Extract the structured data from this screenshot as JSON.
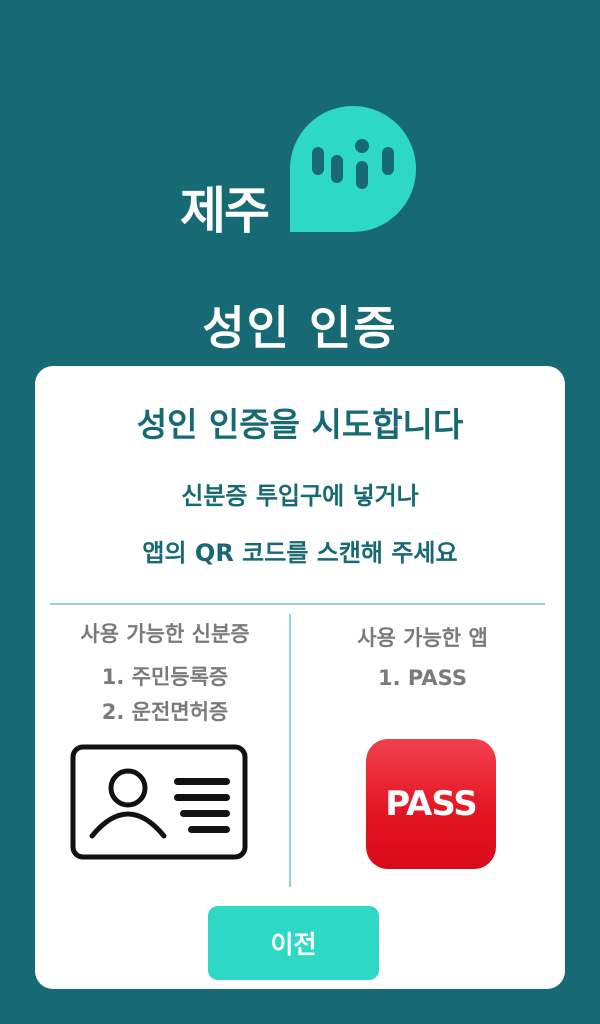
{
  "logo": {
    "text": "제주",
    "icon": "speech-bubble-logo-icon",
    "color": "#2dd8c4"
  },
  "page_title": "성인 인증",
  "card": {
    "heading": "성인 인증을 시도합니다",
    "instruction_line1": "신분증 투입구에 넣거나",
    "instruction_line2": "앱의 QR 코드를 스캔해 주세요"
  },
  "id_section": {
    "heading": "사용 가능한 신분증",
    "items": [
      "1. 주민등록증",
      "2. 운전면허증"
    ],
    "icon": "id-card-icon"
  },
  "app_section": {
    "heading": "사용 가능한 앱",
    "items": [
      "1. PASS"
    ],
    "app_icon_label": "PASS"
  },
  "back_button": {
    "label": "이전"
  },
  "colors": {
    "background": "#176a74",
    "accent": "#2dd8c4",
    "card": "#ffffff",
    "pass_red": "#e41622"
  }
}
